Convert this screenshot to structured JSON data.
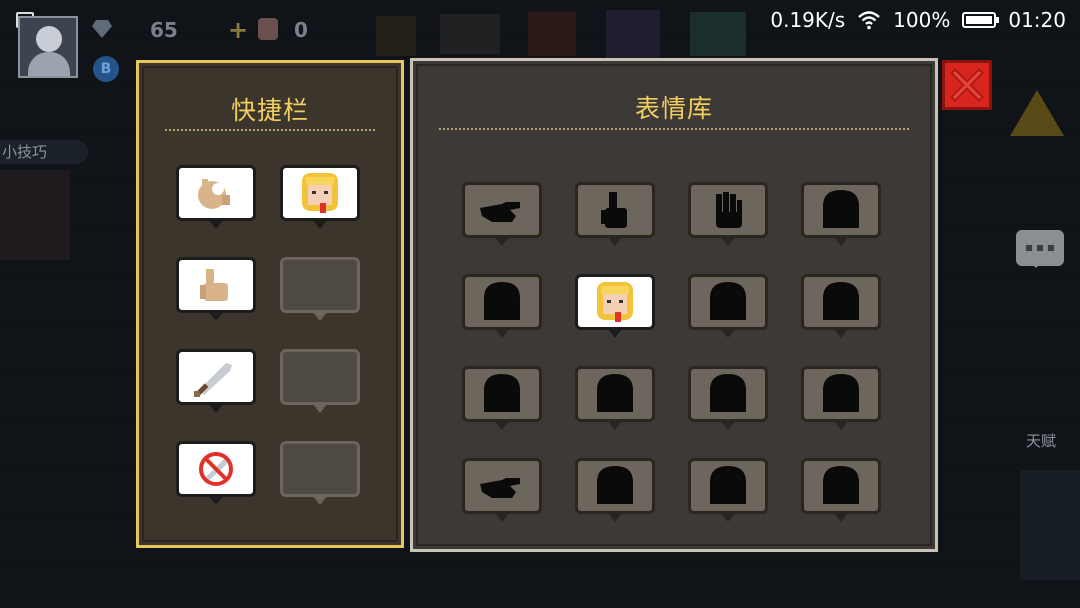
{
  "status_bar": {
    "speed": "0.19K/s",
    "battery": "100%",
    "battery_level": 1.0,
    "time": "01:20",
    "left_dots": "..."
  },
  "hud": {
    "gems": "65",
    "potions": "0",
    "plus": "+",
    "coin_letter": "B",
    "tips_label": "小技巧",
    "talent_label": "天赋"
  },
  "quickbar": {
    "title": "快捷栏",
    "slots": [
      {
        "state": "filled",
        "icon": "ok-hand-icon"
      },
      {
        "state": "filled",
        "icon": "blonde-girl-icon"
      },
      {
        "state": "filled",
        "icon": "thumbs-up-hand-icon"
      },
      {
        "state": "empty"
      },
      {
        "state": "filled",
        "icon": "sword-icon"
      },
      {
        "state": "empty"
      },
      {
        "state": "filled",
        "icon": "no-sword-icon"
      },
      {
        "state": "empty"
      }
    ]
  },
  "library": {
    "title": "表情库",
    "slots": [
      {
        "state": "locked",
        "icon": "pointing-hand-silhouette-icon"
      },
      {
        "state": "locked",
        "icon": "thumbs-up-silhouette-icon"
      },
      {
        "state": "locked",
        "icon": "open-hand-silhouette-icon"
      },
      {
        "state": "locked",
        "icon": "head-silhouette-icon"
      },
      {
        "state": "locked",
        "icon": "head-silhouette-icon"
      },
      {
        "state": "filled",
        "icon": "blonde-girl-icon"
      },
      {
        "state": "locked",
        "icon": "head-silhouette-icon"
      },
      {
        "state": "locked",
        "icon": "head-silhouette-icon"
      },
      {
        "state": "locked",
        "icon": "head-silhouette-icon"
      },
      {
        "state": "locked",
        "icon": "head-silhouette-icon"
      },
      {
        "state": "locked",
        "icon": "head-silhouette-icon"
      },
      {
        "state": "locked",
        "icon": "head-silhouette-icon"
      },
      {
        "state": "locked",
        "icon": "pointing-hand-silhouette-icon"
      },
      {
        "state": "locked",
        "icon": "head-silhouette-icon"
      },
      {
        "state": "locked",
        "icon": "head-silhouette-icon"
      },
      {
        "state": "locked",
        "icon": "head-silhouette-icon"
      }
    ]
  },
  "colors": {
    "title_gold": "#f2cf5e",
    "quickbar_border": "#e5c55e",
    "library_border": "#c9c2b6",
    "close_red": "#d8261f"
  }
}
